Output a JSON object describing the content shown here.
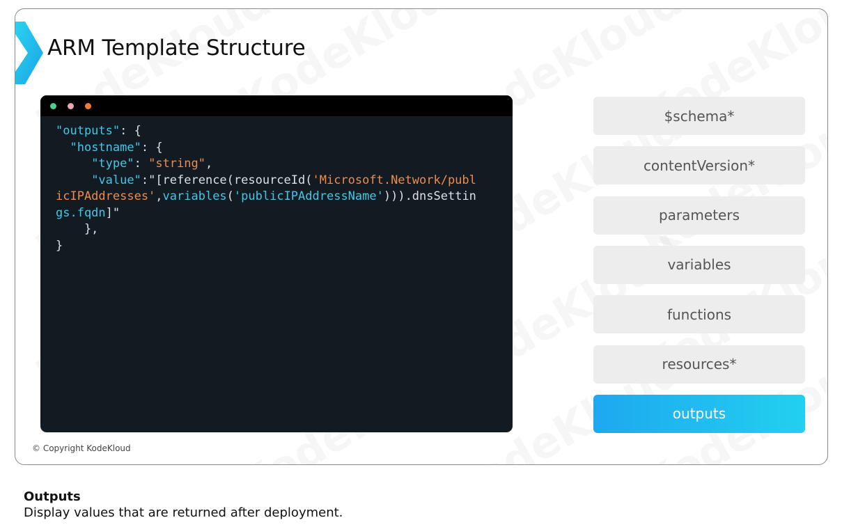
{
  "slide": {
    "title": "ARM Template Structure",
    "watermark": "KodeKloud",
    "copyright": "© Copyright KodeKloud",
    "accent_color": "#1fb6ef"
  },
  "code_window": {
    "lines": [
      {
        "segments": [
          {
            "type": "key",
            "text": "\"outputs\""
          },
          {
            "type": "plain",
            "text": ": {"
          }
        ]
      },
      {
        "segments": [
          {
            "type": "plain",
            "text": "  "
          },
          {
            "type": "key",
            "text": "\"hostname\""
          },
          {
            "type": "plain",
            "text": ": {"
          }
        ]
      },
      {
        "segments": [
          {
            "type": "plain",
            "text": "     "
          },
          {
            "type": "key",
            "text": "\"type\""
          },
          {
            "type": "plain",
            "text": ": "
          },
          {
            "type": "str",
            "text": "\"string\""
          },
          {
            "type": "plain",
            "text": ","
          }
        ]
      },
      {
        "segments": [
          {
            "type": "plain",
            "text": "     "
          },
          {
            "type": "key",
            "text": "\"value\""
          },
          {
            "type": "plain",
            "text": ":\"[reference(resourceId("
          },
          {
            "type": "str",
            "text": "'Microsoft.Network/publ"
          }
        ]
      },
      {
        "segments": [
          {
            "type": "str",
            "text": "icIPAddresses'"
          },
          {
            "type": "plain",
            "text": ","
          },
          {
            "type": "fn",
            "text": "variables"
          },
          {
            "type": "plain",
            "text": "("
          },
          {
            "type": "fn",
            "text": "'publicIPAddressName'"
          },
          {
            "type": "plain",
            "text": "))).dnsSettin"
          }
        ]
      },
      {
        "segments": [
          {
            "type": "fn",
            "text": "gs.fqdn"
          },
          {
            "type": "plain",
            "text": "]\""
          }
        ]
      },
      {
        "segments": [
          {
            "type": "plain",
            "text": "    },"
          }
        ]
      },
      {
        "segments": [
          {
            "type": "plain",
            "text": "}"
          }
        ]
      }
    ]
  },
  "menu": {
    "items": [
      {
        "label": "$schema*",
        "active": false
      },
      {
        "label": "contentVersion*",
        "active": false
      },
      {
        "label": "parameters",
        "active": false
      },
      {
        "label": "variables",
        "active": false
      },
      {
        "label": "functions",
        "active": false
      },
      {
        "label": "resources*",
        "active": false
      },
      {
        "label": "outputs",
        "active": true
      }
    ]
  },
  "caption": {
    "title": "Outputs",
    "text": "Display values that are returned after deployment."
  }
}
